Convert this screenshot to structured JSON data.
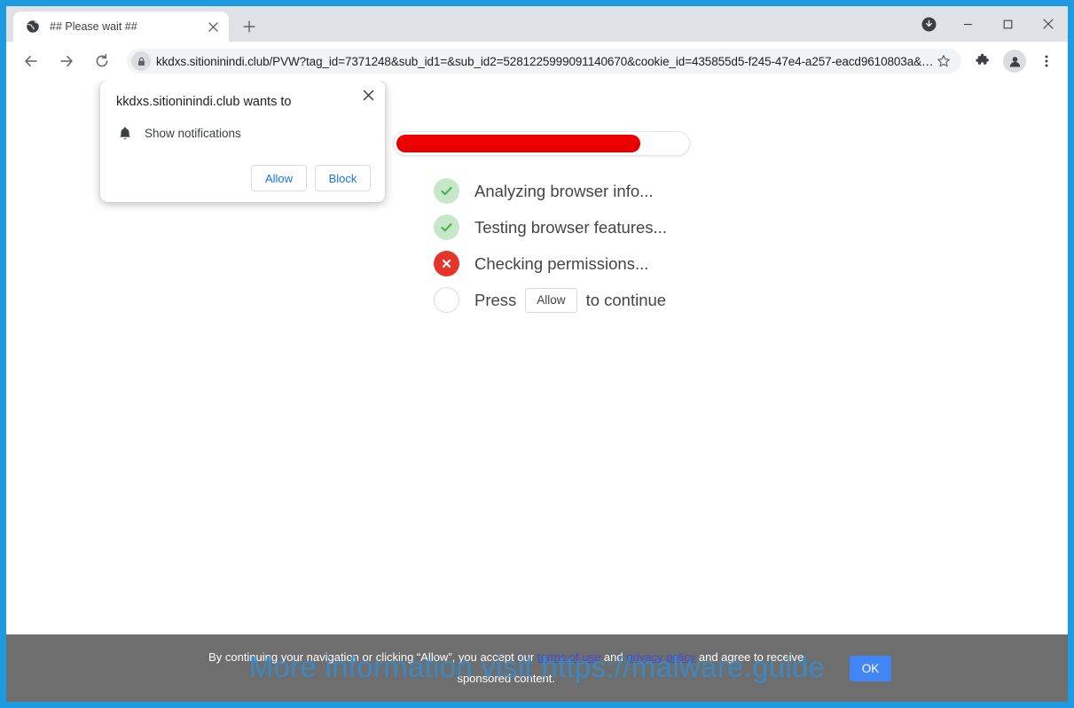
{
  "browser": {
    "tab": {
      "title": "## Please wait ##",
      "favicon": "globe-icon",
      "close": "×"
    },
    "new_tab_label": "+",
    "window_controls": {
      "minimize": "—",
      "maximize": "□",
      "close": "✕"
    },
    "nav": {
      "back": "back-arrow-icon",
      "forward": "forward-arrow-icon",
      "reload": "reload-icon"
    },
    "omnibox": {
      "url": "kkdxs.sitioninindi.club/PVW?tag_id=7371248&sub_id1=&sub_id2=5281225999091140670&cookie_id=435855d5-f245-47e4-a257-eacd9610803a&…",
      "lock_icon": "lock-icon",
      "star_icon": "star-icon"
    },
    "toolbar_icons": {
      "extensions": "puzzle-icon",
      "profile": "person-icon",
      "menu": "three-dot-menu-icon",
      "downloads": "download-icon"
    }
  },
  "permission_bubble": {
    "title": "kkdxs.sitioninindi.club wants to",
    "request_icon": "bell-icon",
    "request_label": "Show notifications",
    "allow_label": "Allow",
    "block_label": "Block",
    "close_label": "×"
  },
  "page": {
    "progress": {
      "percent": 84
    },
    "checklist": [
      {
        "status": "ok",
        "icon": "check-icon",
        "label": "Analyzing browser info..."
      },
      {
        "status": "ok",
        "icon": "check-icon",
        "label": "Testing browser features..."
      },
      {
        "status": "fail",
        "icon": "cross-icon",
        "label": "Checking permissions..."
      },
      {
        "status": "pend",
        "icon": "empty-circle-icon",
        "label_before": "Press",
        "button_label": "Allow",
        "label_after": "to continue"
      }
    ]
  },
  "consent_bar": {
    "text_part1": "By continuing your navigation or clicking “Allow”, you accept our ",
    "link_terms": "terms of use",
    "text_part2": " and ",
    "link_privacy": "privacy policy",
    "text_part3": " and agree to receive sponsored content.",
    "ok_label": "OK"
  },
  "watermark": {
    "text": "More information visit https://malware.guide"
  },
  "colors": {
    "frame_blue": "#1E9BE0",
    "progress_red": "#EE0000",
    "fail_red": "#E5342A",
    "ok_green_bg": "#C6E8C8",
    "ok_green_check": "#4CAF50",
    "consent_gray": "#6E6E6E",
    "ok_button_blue": "#4285F4",
    "link_blue": "#3C4FD8",
    "watermark_blue": "#2F8FD8"
  }
}
